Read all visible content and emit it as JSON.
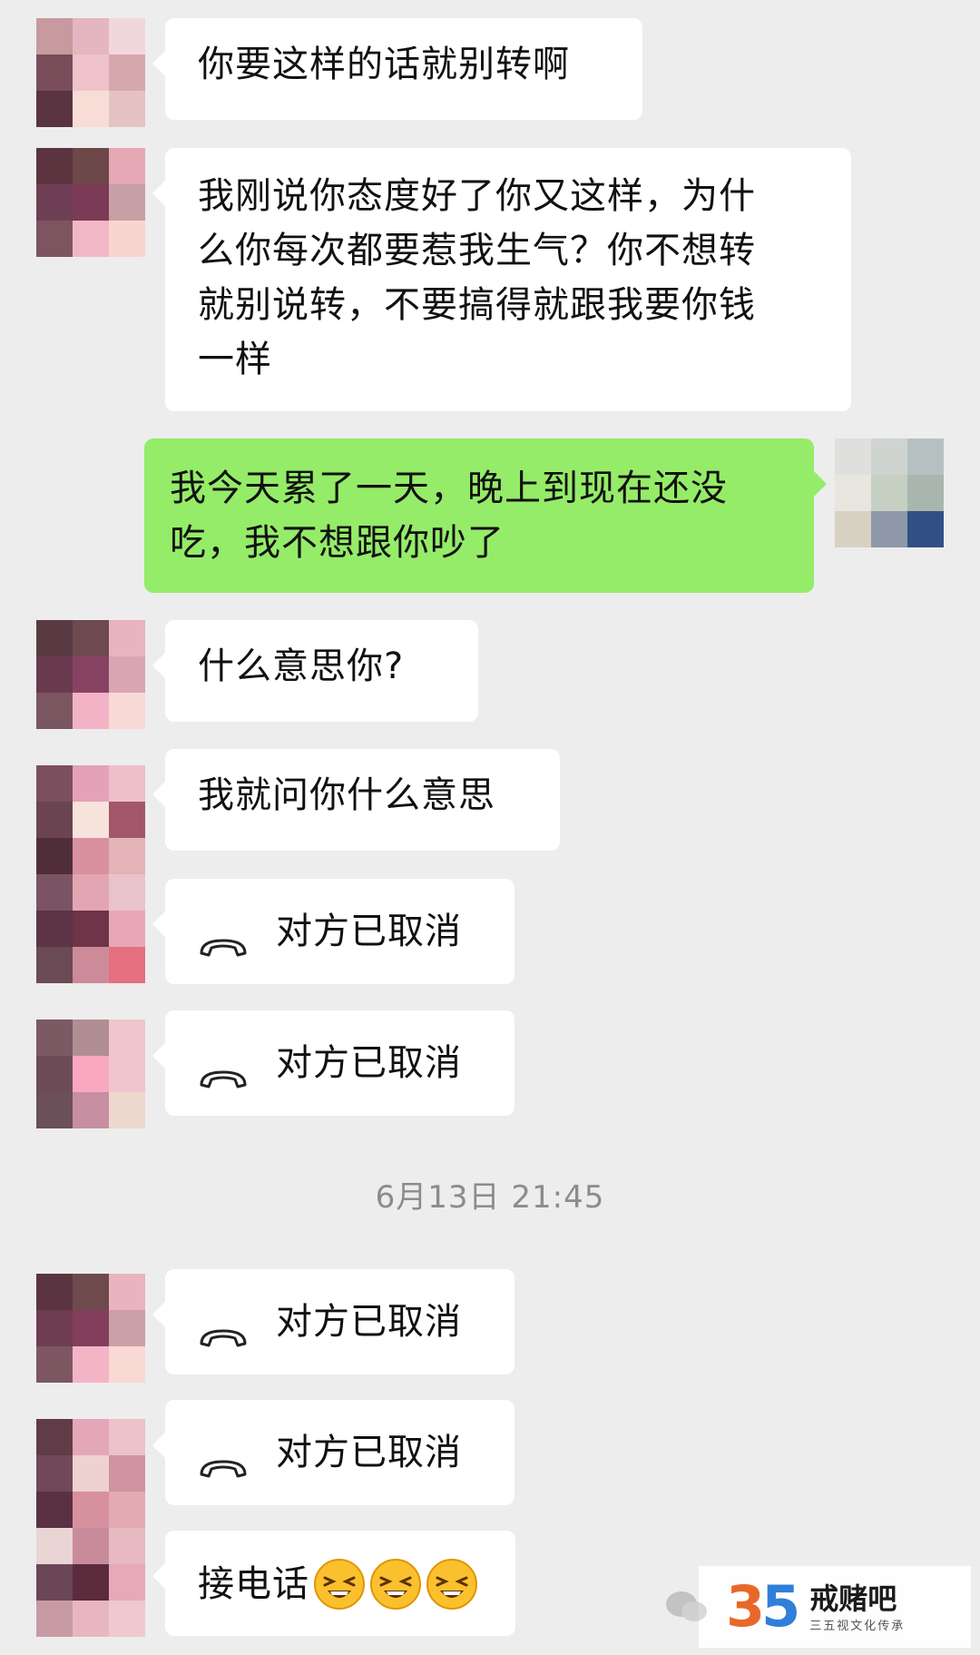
{
  "messages": [
    {
      "side": "left",
      "text": "你要这样的话就别转啊"
    },
    {
      "side": "left",
      "lines": [
        "我刚说你态度好了你又这样，为什",
        "么你每次都要惹我生气？你不想转",
        "就别说转，不要搞得就跟我要你钱",
        "一样"
      ]
    },
    {
      "side": "right",
      "lines": [
        "我今天累了一天，晚上到现在还没",
        "吃，我不想跟你吵了"
      ]
    },
    {
      "side": "left",
      "text": "什么意思你?"
    },
    {
      "side": "left",
      "text": "我就问你什么意思"
    },
    {
      "side": "left",
      "type": "call",
      "text": "对方已取消"
    },
    {
      "side": "left",
      "type": "call",
      "text": "对方已取消"
    },
    {
      "side": "left",
      "type": "call",
      "text": "对方已取消"
    },
    {
      "side": "left",
      "type": "call",
      "text": "对方已取消"
    },
    {
      "side": "left",
      "text": "接电话",
      "emoji": [
        "weary-face-emoji",
        "weary-face-emoji",
        "weary-face-emoji"
      ]
    }
  ],
  "timestamp": "6月13日 21:45",
  "watermark": {
    "number_a": "3",
    "number_b": "5",
    "title": "戒赌吧",
    "subtitle": "三五视文化传承"
  },
  "colors": {
    "background": "#ededed",
    "bubble_left": "#ffffff",
    "bubble_right": "#95ec69"
  }
}
